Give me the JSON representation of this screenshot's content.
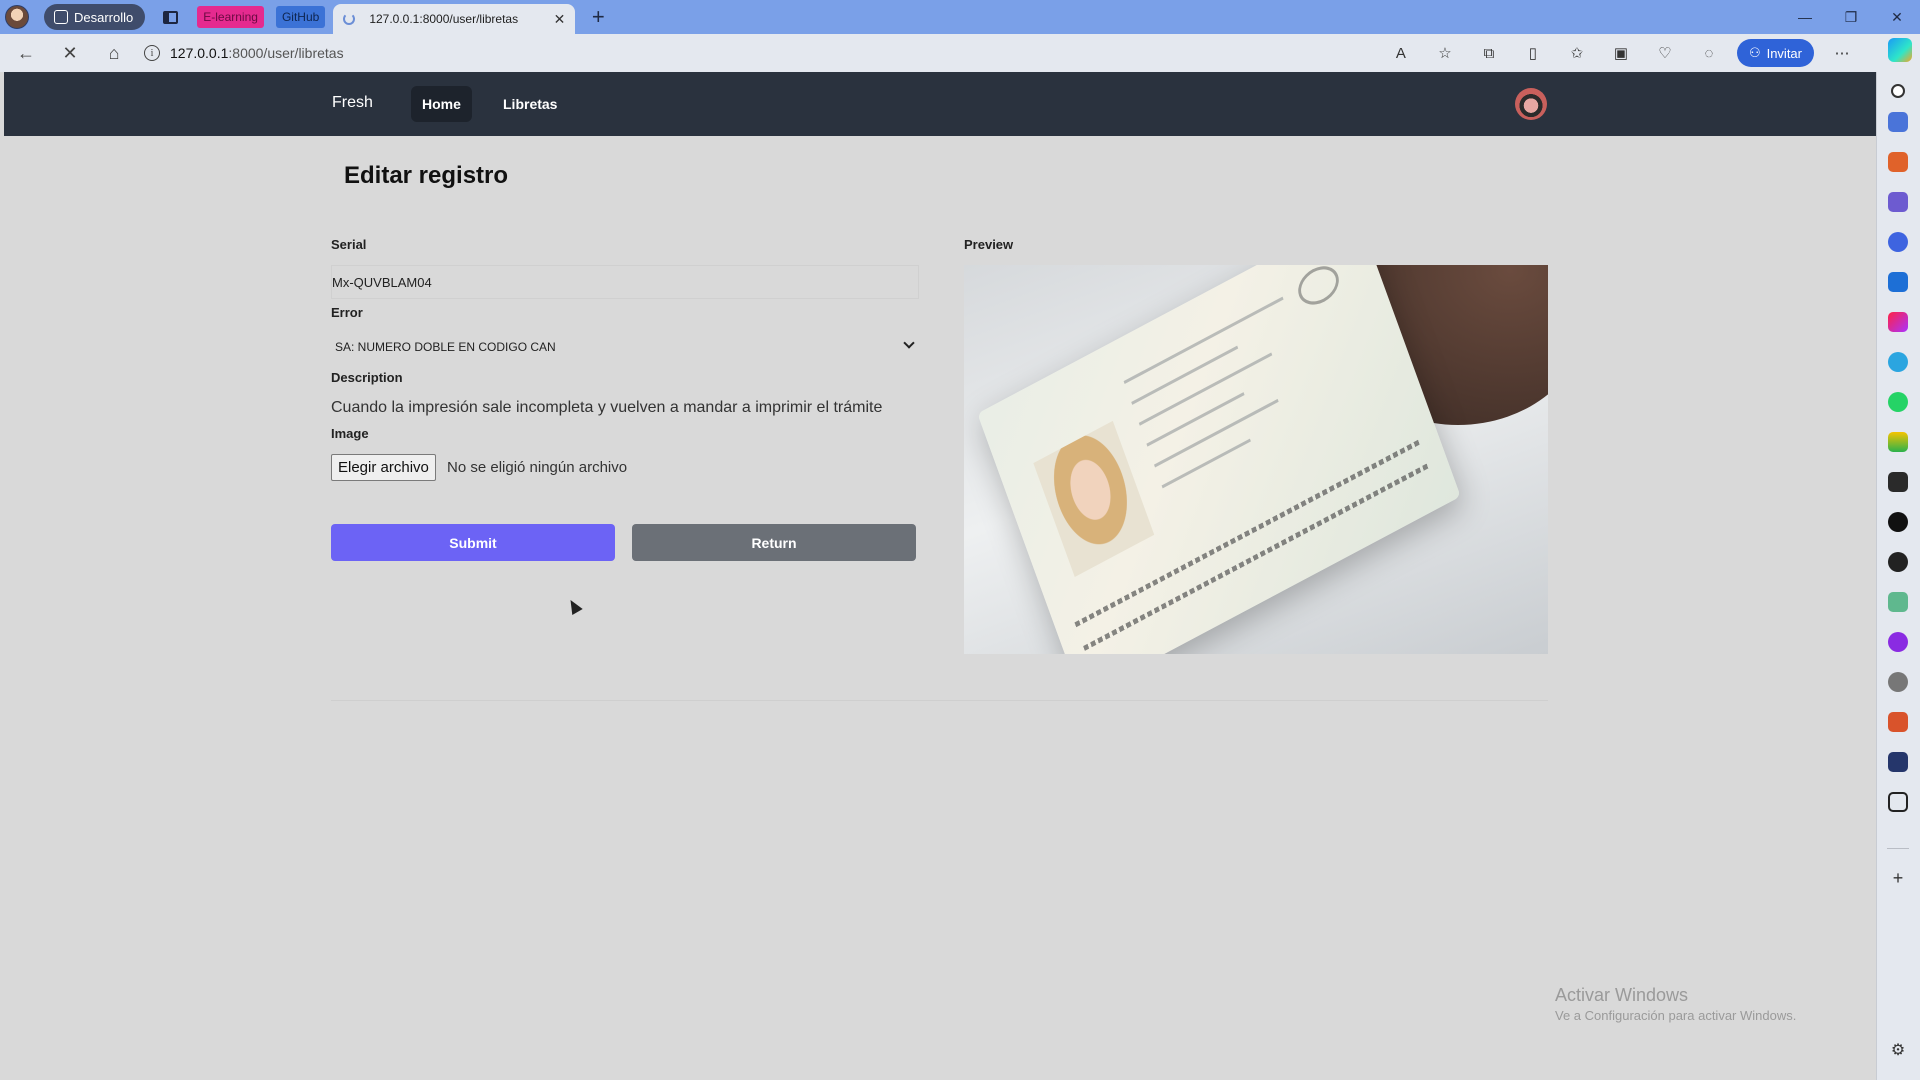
{
  "browser": {
    "workspace_label": "Desarrollo",
    "pinned_tabs": [
      "E-learning",
      "GitHub"
    ],
    "active_tab_title": "127.0.0.1:8000/user/libretas",
    "url_host": "127.0.0.1",
    "url_path": ":8000/user/libretas",
    "invite_label": "Invitar",
    "close_tab_glyph": "✕",
    "new_tab_glyph": "+"
  },
  "navbar": {
    "brand": "Fresh",
    "links": [
      "Home",
      "Libretas"
    ],
    "active_link": "Home"
  },
  "form": {
    "title": "Editar registro",
    "serial_label": "Serial",
    "serial_value": "Mx-QUVBLAM04",
    "error_label": "Error",
    "error_selected": "SA: NUMERO DOBLE EN CODIGO CAN",
    "description_label": "Description",
    "description_value": "Cuando la impresión sale incompleta y vuelven a mandar a imprimir el trámite",
    "image_label": "Image",
    "file_button": "Elegir archivo",
    "file_status": "No se eligió ningún archivo",
    "submit_label": "Submit",
    "return_label": "Return"
  },
  "preview": {
    "label": "Preview"
  },
  "watermark": {
    "line1": "Activar Windows",
    "line2": "Ve a Configuración para activar Windows."
  },
  "colors": {
    "submit": "#6c63f5",
    "return": "#6b7077",
    "navbar": "#2a323e",
    "tabbar": "#7aa0e8"
  }
}
